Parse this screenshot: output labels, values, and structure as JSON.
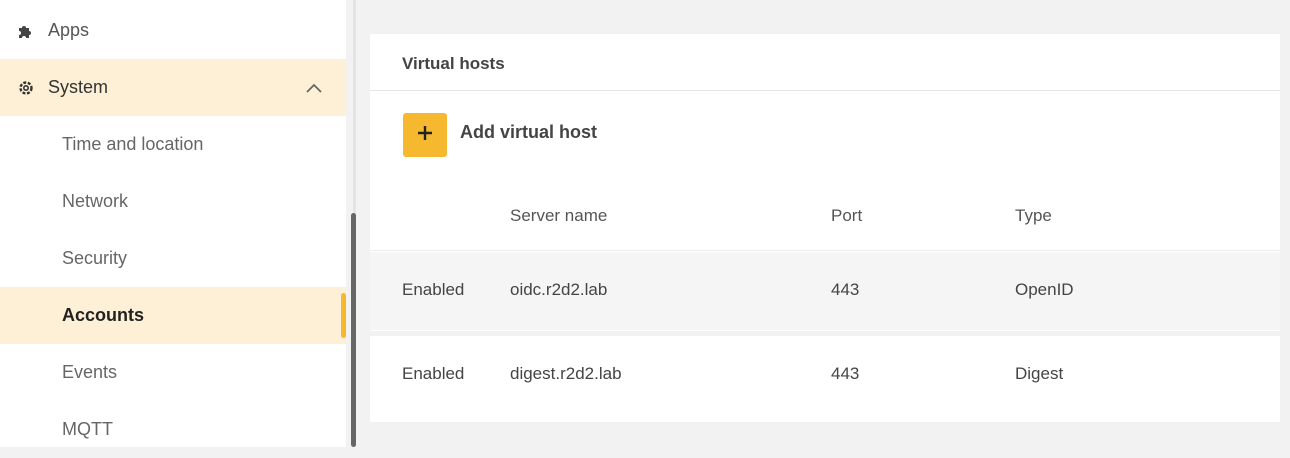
{
  "sidebar": {
    "apps_label": "Apps",
    "system_label": "System",
    "sub_items": [
      "Time and location",
      "Network",
      "Security",
      "Accounts",
      "Events",
      "MQTT"
    ],
    "active_item": "Accounts"
  },
  "card": {
    "title": "Virtual hosts",
    "add_label": "Add virtual host",
    "columns": [
      "Server name",
      "Port",
      "Type"
    ],
    "rows": [
      {
        "status": "Enabled",
        "server": "oidc.r2d2.lab",
        "port": "443",
        "type": "OpenID"
      },
      {
        "status": "Enabled",
        "server": "digest.r2d2.lab",
        "port": "443",
        "type": "Digest"
      }
    ]
  },
  "colors": {
    "accent": "#f5b82e",
    "highlight": "#fdf0d6"
  }
}
